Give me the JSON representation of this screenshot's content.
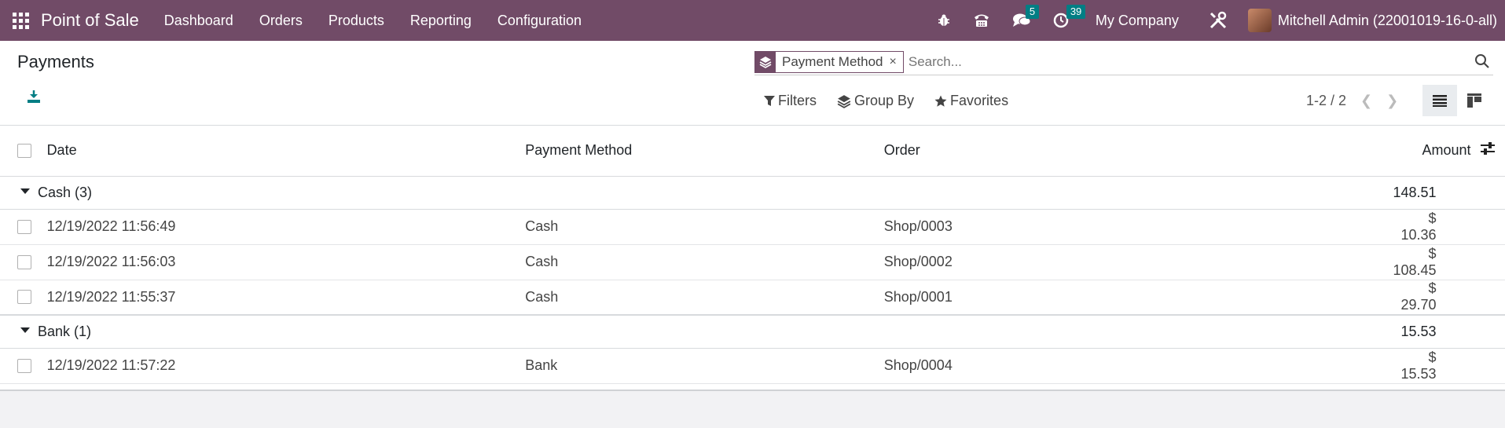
{
  "navbar": {
    "app_name": "Point of Sale",
    "menu": [
      "Dashboard",
      "Orders",
      "Products",
      "Reporting",
      "Configuration"
    ],
    "messages_badge": "5",
    "activities_badge": "39",
    "company": "My Company",
    "user": "Mitchell Admin (22001019-16-0-all)"
  },
  "page": {
    "title": "Payments"
  },
  "search": {
    "facet_label": "Payment Method",
    "facet_close": "×",
    "placeholder": "Search..."
  },
  "filters": {
    "filters_label": "Filters",
    "groupby_label": "Group By",
    "favorites_label": "Favorites"
  },
  "pager": {
    "value": "1-2 / 2"
  },
  "table": {
    "columns": [
      "Date",
      "Payment Method",
      "Order",
      "Amount"
    ],
    "groups": [
      {
        "label": "Cash (3)",
        "total": "148.51",
        "rows": [
          {
            "date": "12/19/2022 11:56:49",
            "method": "Cash",
            "order": "Shop/0003",
            "amount": "$ 10.36"
          },
          {
            "date": "12/19/2022 11:56:03",
            "method": "Cash",
            "order": "Shop/0002",
            "amount": "$ 108.45"
          },
          {
            "date": "12/19/2022 11:55:37",
            "method": "Cash",
            "order": "Shop/0001",
            "amount": "$ 29.70"
          }
        ]
      },
      {
        "label": "Bank (1)",
        "total": "15.53",
        "rows": [
          {
            "date": "12/19/2022 11:57:22",
            "method": "Bank",
            "order": "Shop/0004",
            "amount": "$ 15.53"
          }
        ]
      }
    ]
  },
  "colors": {
    "brand": "#714b67",
    "badge": "#017e84",
    "download": "#017e84"
  }
}
